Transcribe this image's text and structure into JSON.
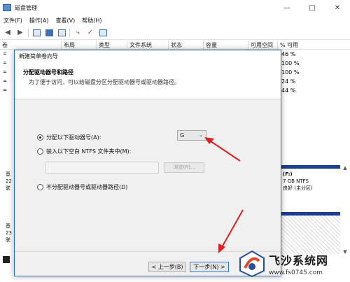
{
  "app": {
    "title": "磁盘管理",
    "controls": [
      "—",
      "□",
      "✕"
    ],
    "menu": [
      "文件(F)",
      "操作(A)",
      "查看(V)",
      "帮助(H)"
    ],
    "columns": [
      "卷",
      "布局",
      "类型",
      "文件系统",
      "状态",
      "容量",
      "可用空间",
      "% 可用"
    ],
    "volume_rows": [
      {
        "left": "=",
        "right": "46 %"
      },
      {
        "left": "=",
        "right": "100 %"
      },
      {
        "left": "=",
        "right": "100 %"
      },
      {
        "left": "=",
        "right": "24 %"
      },
      {
        "left": "=",
        "right": "44 %"
      }
    ],
    "disk_rows": [
      {
        "a": "基",
        "b": "22",
        "c": "联"
      },
      {
        "a": "基",
        "b": "23",
        "c": "联"
      }
    ],
    "partition_f": {
      "name": "(F:)",
      "size": "7 GB NTFS",
      "status": "良好 (主分区)"
    }
  },
  "dialog": {
    "title": "新建简单卷向导",
    "heading": "分配驱动器号和路径",
    "subheading": "为了便于访问，可以给磁盘分区分配驱动器号或驱动器路径。",
    "options": {
      "assign_letter": "分配以下驱动器号(A):",
      "mount_folder": "装入以下空白 NTFS 文件夹中(M):",
      "no_assign": "不分配驱动器号或驱动器路径(D)"
    },
    "drive_letter": "G",
    "browse": "浏览(R)...",
    "prev": "< 上一步(B)",
    "next": "下一步(N) >"
  },
  "watermark": {
    "text": "飞沙系统网",
    "url": "www.fs0745.com"
  },
  "colors": {
    "accent": "#2b6fc4",
    "arrow": "#e02020",
    "disk_bar": "#1b3f8f"
  }
}
